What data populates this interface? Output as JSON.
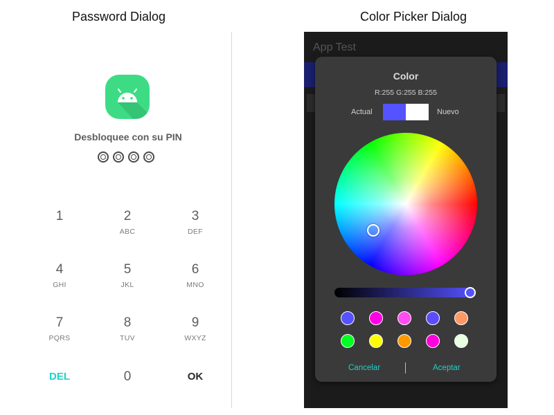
{
  "captions": {
    "left": "Password Dialog",
    "right": "Color Picker Dialog"
  },
  "password_dialog": {
    "app_icon": "android-robot-icon",
    "prompt": "Desbloquee con su PIN",
    "pin_length": 4,
    "keypad": [
      {
        "num": "1",
        "letters": ""
      },
      {
        "num": "2",
        "letters": "ABC"
      },
      {
        "num": "3",
        "letters": "DEF"
      },
      {
        "num": "4",
        "letters": "GHI"
      },
      {
        "num": "5",
        "letters": "JKL"
      },
      {
        "num": "6",
        "letters": "MNO"
      },
      {
        "num": "7",
        "letters": "PQRS"
      },
      {
        "num": "8",
        "letters": "TUV"
      },
      {
        "num": "9",
        "letters": "WXYZ"
      }
    ],
    "del_label": "DEL",
    "zero_label": "0",
    "ok_label": "OK",
    "colors": {
      "accent": "#1fd1c9",
      "icon_bg": "#3ddc84"
    }
  },
  "phone": {
    "app_title": "App Test"
  },
  "color_picker": {
    "title": "Color",
    "rgb_text": "R:255 G:255 B:255",
    "actual_label": "Actual",
    "nuevo_label": "Nuevo",
    "current_color": "#5552ff",
    "new_color": "#ffffff",
    "presets": [
      "#5552ff",
      "#ff00e6",
      "#ff4df0",
      "#5b4cff",
      "#ff9966",
      "#00ff22",
      "#ffff00",
      "#ff9900",
      "#ff00dd",
      "#e8ffe0"
    ],
    "cancel_label": "Cancelar",
    "accept_label": "Aceptar"
  }
}
